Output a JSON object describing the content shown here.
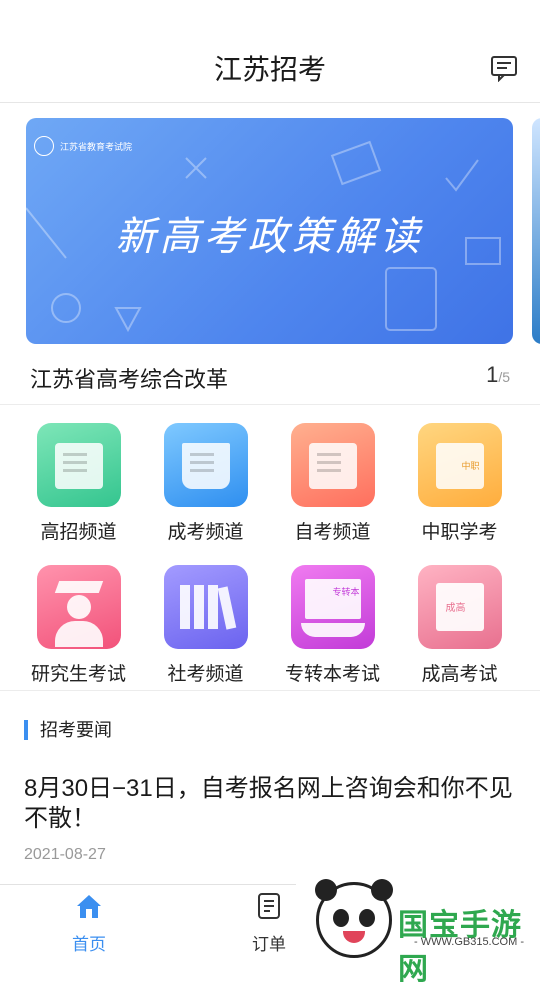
{
  "header": {
    "title": "江苏招考",
    "message_icon": "message-icon"
  },
  "banner": {
    "org": "江苏省教育考试院",
    "headline": "新高考政策解读",
    "caption": "江苏省高考综合改革",
    "page_current": "1",
    "page_total": "/5"
  },
  "channels": [
    {
      "label": "高招频道",
      "color_from": "#7ee6b8",
      "color_to": "#34c58f",
      "icon": "checklist-icon"
    },
    {
      "label": "成考频道",
      "color_from": "#7fc9ff",
      "color_to": "#2f8ff0",
      "icon": "open-book-icon"
    },
    {
      "label": "自考频道",
      "color_from": "#ffb08f",
      "color_to": "#ff6f5e",
      "icon": "document-pen-icon"
    },
    {
      "label": "中职学考",
      "color_from": "#ffd680",
      "color_to": "#ffad3d",
      "icon": "books-stack-icon"
    },
    {
      "label": "研究生考试",
      "color_from": "#ff93ad",
      "color_to": "#f2527a",
      "icon": "graduate-icon"
    },
    {
      "label": "社考频道",
      "color_from": "#a39bff",
      "color_to": "#6b63ef",
      "icon": "bookshelf-icon"
    },
    {
      "label": "专转本考试",
      "color_from": "#f07bf0",
      "color_to": "#c23bd8",
      "icon": "certificate-icon"
    },
    {
      "label": "成高考试",
      "color_from": "#ffb3c3",
      "color_to": "#e8708f",
      "icon": "book-icon"
    }
  ],
  "channel_badges": {
    "zhongzhi": "中职",
    "zhuanzhuanben": "专转本",
    "chenggao": "成高"
  },
  "news": {
    "section_title": "招考要闻",
    "title": "8月30日−31日，自考报名网上咨询会和你不见不散！",
    "date": "2021-08-27"
  },
  "tabbar": {
    "tabs": [
      {
        "label": "首页",
        "active": true,
        "icon": "home-icon"
      },
      {
        "label": "订单",
        "active": false,
        "icon": "order-icon"
      }
    ],
    "active_color": "#3b8ff0"
  },
  "watermark": {
    "text": "国宝手游网",
    "url": "- WWW.GB315.COM -"
  }
}
